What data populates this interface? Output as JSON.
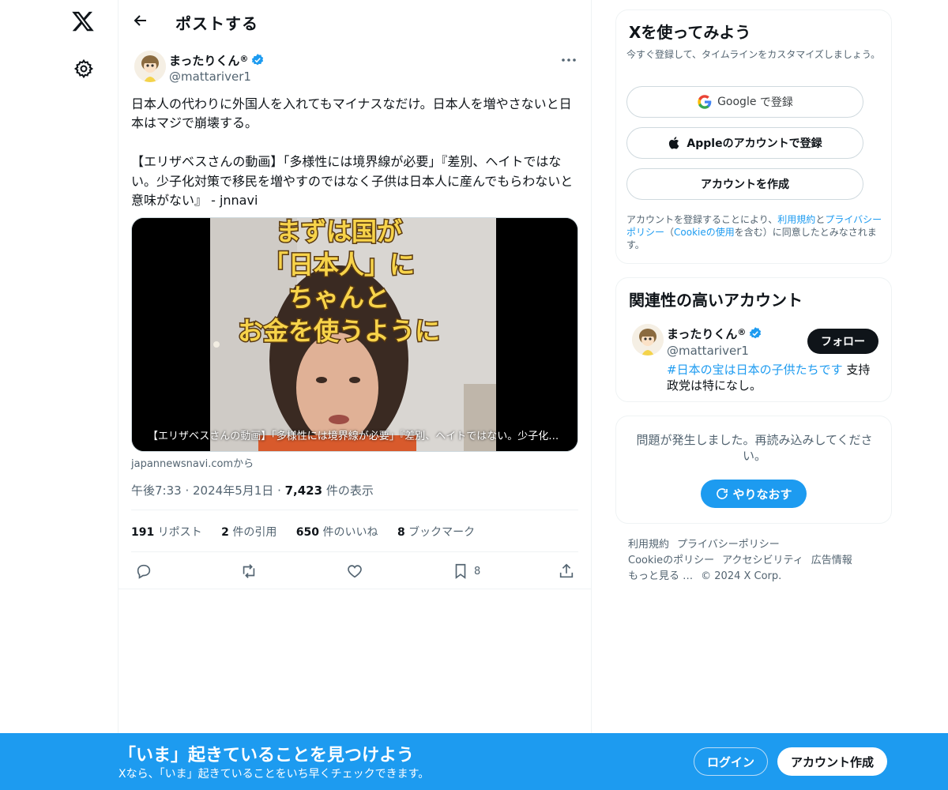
{
  "header": {
    "title": "ポストする",
    "back_icon": "arrow-left-icon"
  },
  "nav": {
    "logo_icon": "x-logo-icon",
    "settings_icon": "gear-icon"
  },
  "post": {
    "author_name": "まったりくん",
    "author_name_suffix": "®",
    "author_handle": "@mattariver1",
    "text": "日本人の代わりに外国人を入れてもマイナスなだけ。日本人を増やさないと日本はマジで崩壊する。\n\n【エリザベスさんの動画】「多様性には境界線が必要」『差別、ヘイトではない。少子化対策で移民を増やすのではなく子供は日本人に産んでもらわないと意味がない』 - jnnavi",
    "card": {
      "overlay_text": [
        "まずは国が",
        "「日本人」に",
        "ちゃんと",
        "お金を使うように"
      ],
      "title": "【エリザベスさんの動画】「多様性には境界線が必要」『差別、ヘイトではない。少子化…",
      "source": "japannewsnavi.comから"
    },
    "time": "午後7:33",
    "date": "2024年5月1日",
    "views_count": "7,423",
    "views_label": "件の表示",
    "stats": [
      {
        "count": "191",
        "label": "リポスト"
      },
      {
        "count": "2",
        "label": "件の引用"
      },
      {
        "count": "650",
        "label": "件のいいね"
      },
      {
        "count": "8",
        "label": "ブックマーク"
      }
    ],
    "bookmark_count": "8"
  },
  "signup_panel": {
    "title": "Xを使ってみよう",
    "subtitle": "今すぐ登録して、タイムラインをカスタマイズしましょう。",
    "google_brand": "Google",
    "google_suffix": "で登録",
    "apple_button": "Appleのアカウントで登録",
    "create_button": "アカウントを作成",
    "legal_prefix": "アカウントを登録することにより、",
    "legal_terms": "利用規約",
    "legal_and": "と",
    "legal_privacy": "プライバシーポリシー",
    "legal_paren_open": "（",
    "legal_cookie": "Cookieの使用",
    "legal_suffix": "を含む）に同意したとみなされます。"
  },
  "related_panel": {
    "title": "関連性の高いアカウント",
    "name": "まったりくん",
    "name_suffix": "®",
    "handle": "@mattariver1",
    "follow_button": "フォロー",
    "bio_hashtag": "#日本の宝は日本の子供たちです",
    "bio_rest": " 支持政党は特になし。"
  },
  "error_panel": {
    "message": "問題が発生しました。再読み込みしてください。",
    "retry_button": "やりなおす"
  },
  "footer": {
    "links": [
      "利用規約",
      "プライバシーポリシー",
      "Cookieのポリシー",
      "アクセシビリティ",
      "広告情報",
      "もっと見る …"
    ],
    "copyright": "© 2024 X Corp."
  },
  "bottom_bar": {
    "title": "「いま」起きていることを見つけよう",
    "subtitle": "Xなら、「いま」起きていることをいち早くチェックできます。",
    "login_button": "ログイン",
    "signup_button": "アカウント作成"
  },
  "colors": {
    "accent": "#1d9bf0",
    "text": "#0f1419",
    "muted": "#536471",
    "border": "#eff3f4",
    "verified": "#1d9bf0"
  }
}
